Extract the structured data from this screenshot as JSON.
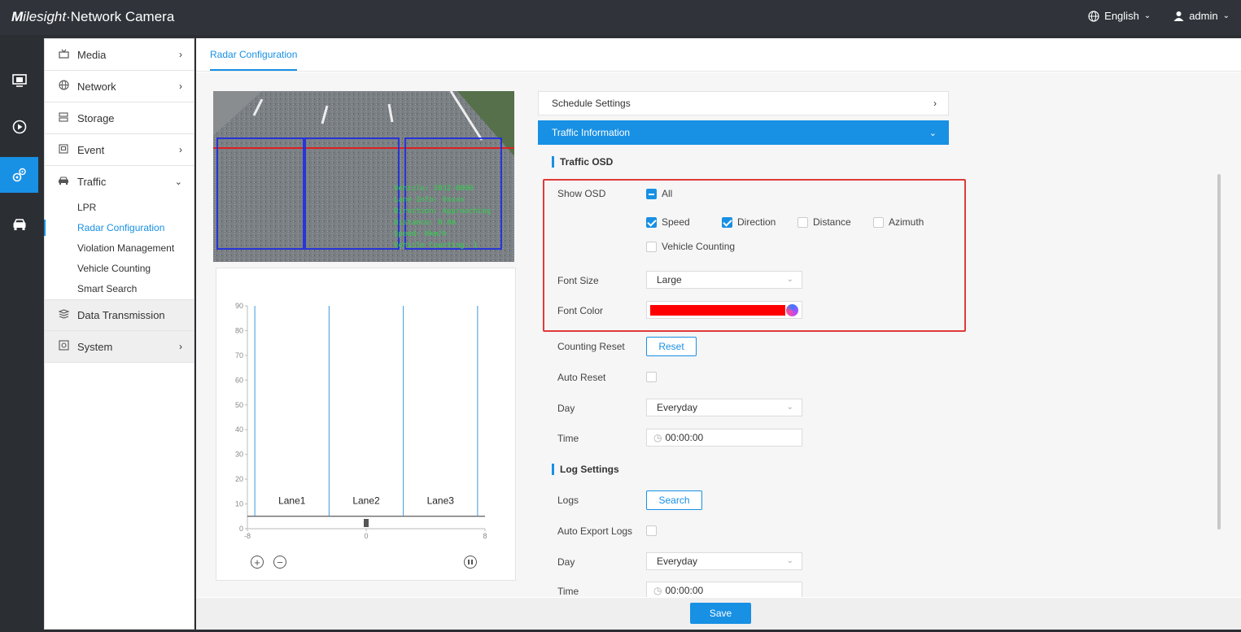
{
  "app": {
    "brand_m": "M",
    "brand_rest": "ilesight",
    "brand_product": "·Network Camera"
  },
  "topbar": {
    "language": "English",
    "user": "admin"
  },
  "sidebar": {
    "items": [
      {
        "label": "Media"
      },
      {
        "label": "Network"
      },
      {
        "label": "Storage"
      },
      {
        "label": "Event"
      },
      {
        "label": "Traffic"
      },
      {
        "label": "Data Transmission"
      },
      {
        "label": "System"
      }
    ],
    "traffic_sub": [
      "LPR",
      "Radar Configuration",
      "Violation Management",
      "Vehicle Counting",
      "Smart Search"
    ]
  },
  "tab": {
    "label": "Radar Configuration"
  },
  "video": {
    "osd_lines": [
      "Vehicle: 2032-0000",
      "Lane Info: 0xxxx",
      "Direction: Approaching",
      "Distance: 0.0m",
      "Speed: 0km/h",
      "Vehicle Counting: 1"
    ]
  },
  "chart_data": {
    "type": "line",
    "y_ticks": [
      "90",
      "80",
      "70",
      "60",
      "50",
      "40",
      "30",
      "20",
      "10",
      "0"
    ],
    "x_ticks": [
      "-8",
      "0",
      "8"
    ],
    "ylim": [
      0,
      90
    ],
    "xlim": [
      -8,
      8
    ],
    "lane_boundaries_x": [
      -7.5,
      -2.5,
      2.5,
      7.5
    ],
    "lanes": [
      "Lane1",
      "Lane2",
      "Lane3"
    ]
  },
  "panel": {
    "schedule_settings": "Schedule Settings",
    "traffic_information": "Traffic Information",
    "traffic_osd": "Traffic OSD",
    "show_osd": "Show OSD",
    "all": "All",
    "speed": "Speed",
    "direction": "Direction",
    "distance": "Distance",
    "azimuth": "Azimuth",
    "vehicle_counting": "Vehicle Counting",
    "font_size_label": "Font Size",
    "font_size_value": "Large",
    "font_color_label": "Font Color",
    "font_color": "#ff0000",
    "counting_reset": "Counting Reset",
    "reset_btn": "Reset",
    "auto_reset": "Auto Reset",
    "day_label": "Day",
    "day_value": "Everyday",
    "time_label": "Time",
    "time_value": "00:00:00",
    "log_settings": "Log Settings",
    "logs_label": "Logs",
    "search_btn": "Search",
    "auto_export_logs": "Auto Export Logs",
    "day2_label": "Day",
    "day2_value": "Everyday",
    "time2_label": "Time",
    "time2_value": "00:00:00"
  },
  "footer": {
    "save": "Save"
  },
  "colors": {
    "accent": "#1890e4",
    "highlight": "#e03a3a"
  }
}
